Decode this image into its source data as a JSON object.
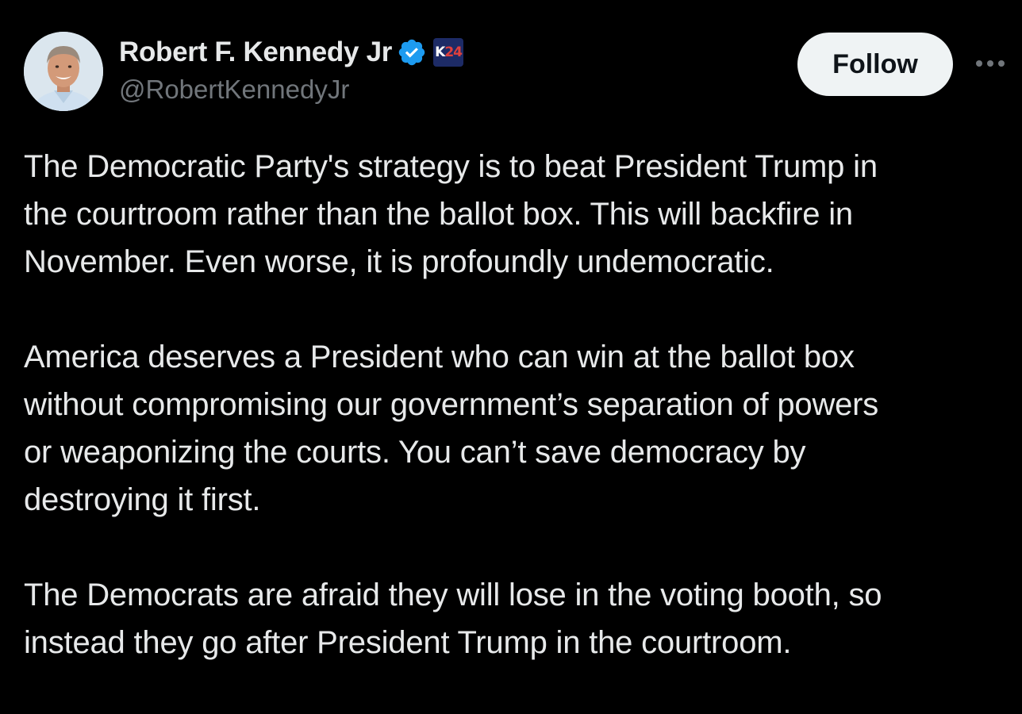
{
  "author": {
    "display_name": "Robert F. Kennedy Jr",
    "handle": "@RobertKennedyJr",
    "verified_icon": "verified-badge-icon",
    "affiliate_badge": {
      "k": "K",
      "n": "24"
    }
  },
  "actions": {
    "follow_label": "Follow",
    "more_icon": "more-icon"
  },
  "post": {
    "paragraphs": [
      {
        "lines": [
          "The Democratic Party's strategy is to beat President Trump in",
          "the courtroom rather than the ballot box. This will backfire in",
          "November. Even worse, it is profoundly undemocratic."
        ]
      },
      {
        "lines": [
          "America deserves a President who can win at the ballot box",
          "without compromising our government’s separation of powers",
          "or weaponizing the courts. You can’t save democracy by",
          "destroying it first."
        ]
      },
      {
        "lines": [
          "The Democrats are afraid they will lose in the voting booth, so",
          "instead they go after President Trump in the courtroom."
        ]
      }
    ]
  },
  "colors": {
    "background": "#000000",
    "text": "#e7e9ea",
    "secondary_text": "#71767b",
    "verified": "#1d9bf0",
    "follow_bg": "#eff3f4"
  }
}
